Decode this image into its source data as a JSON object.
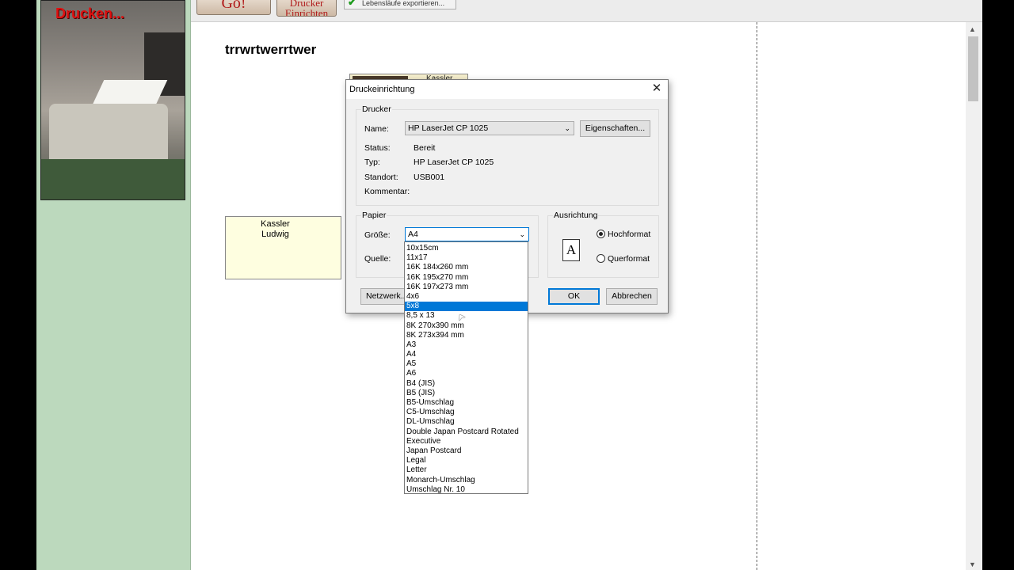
{
  "photo_title": "Drucken...",
  "toolbar": {
    "go_label": "Go!",
    "setup_label": "Drucker\nEinrichten",
    "export_label": "Lebensläufe exportieren..."
  },
  "page": {
    "title": "trrwrtwerrtwer",
    "card_text": "Kassler\nLudwig",
    "card2_text": "Kassler"
  },
  "dialog": {
    "title": "Druckeinrichtung",
    "printer_group": "Drucker",
    "name_label": "Name:",
    "name_value": "HP LaserJet CP 1025",
    "properties_button": "Eigenschaften...",
    "status_label": "Status:",
    "status_value": "Bereit",
    "type_label": "Typ:",
    "type_value": "HP LaserJet CP 1025",
    "location_label": "Standort:",
    "location_value": "USB001",
    "comment_label": "Kommentar:",
    "paper_group": "Papier",
    "size_label": "Größe:",
    "size_value": "A4",
    "source_label": "Quelle:",
    "orientation_group": "Ausrichtung",
    "portrait_label": "Hochformat",
    "landscape_label": "Querformat",
    "orientation_icon": "A",
    "network_button": "Netzwerk...",
    "ok_button": "OK",
    "cancel_button": "Abbrechen"
  },
  "size_options": [
    "10x15cm",
    "11x17",
    "16K 184x260 mm",
    "16K 195x270 mm",
    "16K 197x273 mm",
    "4x6",
    "5x8",
    "8,5 x 13",
    "8K 270x390 mm",
    "8K 273x394 mm",
    "A3",
    "A4",
    "A5",
    "A6",
    "B4 (JIS)",
    "B5 (JIS)",
    "B5-Umschlag",
    "C5-Umschlag",
    "DL-Umschlag",
    "Double Japan Postcard Rotated",
    "Executive",
    "Japan Postcard",
    "Legal",
    "Letter",
    "Monarch-Umschlag",
    "Umschlag Nr. 10"
  ],
  "selected_option": "5x8",
  "colors": {
    "sidebar_green": "#bcd9bd",
    "selection_blue": "#0078d7",
    "title_red": "#e01010"
  }
}
